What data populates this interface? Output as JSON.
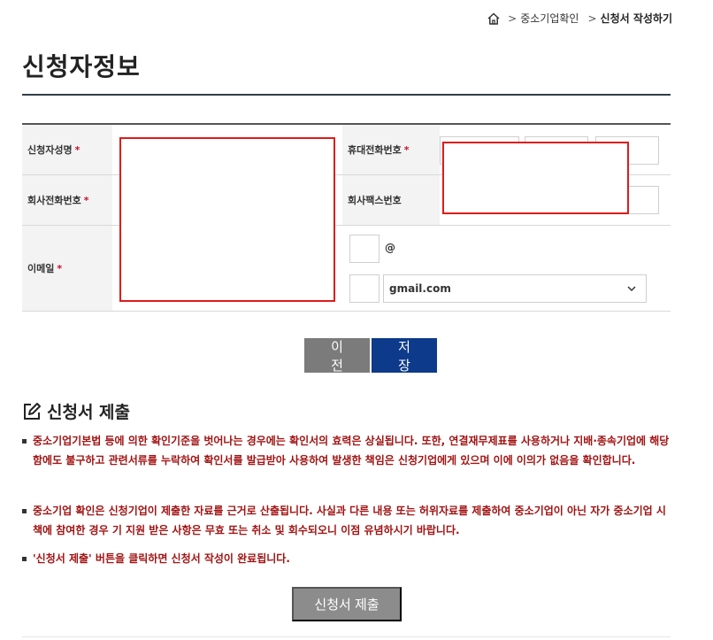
{
  "breadcrumb": {
    "items": [
      "중소기업확인",
      "신청서 작성하기"
    ]
  },
  "page_title": "신청자정보",
  "form": {
    "required_mark": "*",
    "applicant_name_label": "신청자성명",
    "mobile_label": "휴대전화번호",
    "company_phone_label": "회사전화번호",
    "company_fax_label": "회사팩스번호",
    "email_label": "이메일",
    "at_sign": "@",
    "email_domain_selected": "gmail.com"
  },
  "buttons": {
    "prev": "이전",
    "save": "저장",
    "submit": "신청서 제출"
  },
  "section_title": "신청서 제출",
  "notices": [
    "중소기업기본법 등에 의한 확인기준을 벗어나는 경우에는 확인서의 효력은 상실됩니다. 또한, 연결재무제표를 사용하거나 지배·종속기업에 해당함에도 불구하고 관련서류를 누락하여 확인서를 발급받아 사용하여 발생한 책임은 신청기업에게 있으며 이에 이의가 없음을 확인합니다.",
    "중소기업 확인은 신청기업이 제출한 자료를 근거로 산출됩니다. 사실과 다른 내용 또는 허위자료를 제출하여 중소기업이 아닌 자가 중소기업 시책에 참여한 경우 기 지원 받은 사항은 무효 또는 취소 및 회수되오니 이점 유념하시기 바랍니다.",
    "'신청서 제출' 버튼을 클릭하면 신청서 작성이 완료됩니다."
  ],
  "colors": {
    "notice_text": "#a21313",
    "save_button": "#0d3a8a",
    "redaction_border": "#e01b1b"
  },
  "icons": {
    "home": "home-icon",
    "pen": "edit-square-icon",
    "chevron": "chevron-down-icon"
  }
}
